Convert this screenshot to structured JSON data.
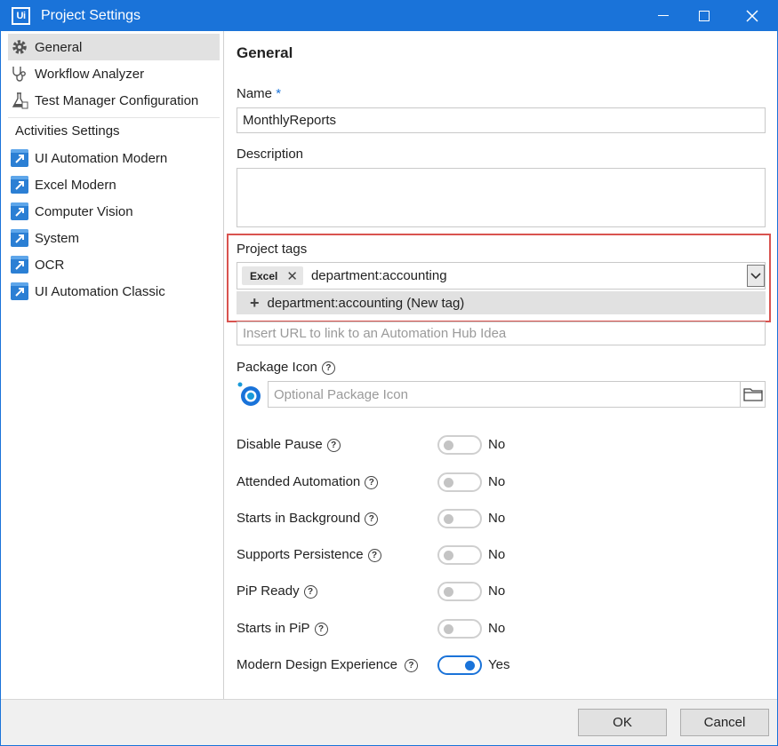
{
  "window": {
    "title": "Project Settings",
    "logo_text": "Ui"
  },
  "sidebar": {
    "items": [
      {
        "label": "General",
        "icon": "gear-icon",
        "selected": true
      },
      {
        "label": "Workflow Analyzer",
        "icon": "stethoscope-icon"
      },
      {
        "label": "Test Manager Configuration",
        "icon": "flask-icon"
      }
    ],
    "section_label": "Activities Settings",
    "activities": [
      {
        "label": "UI Automation Modern",
        "icon": "activity-package-icon"
      },
      {
        "label": "Excel Modern",
        "icon": "activity-package-icon"
      },
      {
        "label": "Computer Vision",
        "icon": "activity-package-icon"
      },
      {
        "label": "System",
        "icon": "activity-package-icon"
      },
      {
        "label": "OCR",
        "icon": "activity-package-icon"
      },
      {
        "label": "UI Automation Classic",
        "icon": "activity-package-icon"
      }
    ]
  },
  "main": {
    "title": "General",
    "name": {
      "label": "Name",
      "required_mark": "*",
      "value": "MonthlyReports"
    },
    "description": {
      "label": "Description",
      "value": ""
    },
    "project_tags": {
      "label": "Project tags",
      "chips": [
        "Excel"
      ],
      "input_value": "department:accounting",
      "suggestion": "department:accounting (New tag)"
    },
    "hub_idea": {
      "placeholder": "Insert URL to link to an Automation Hub Idea"
    },
    "package_icon": {
      "label": "Package Icon",
      "placeholder": "Optional Package Icon"
    },
    "toggles": [
      {
        "label": "Disable Pause",
        "state": "No",
        "on": false
      },
      {
        "label": "Attended Automation",
        "state": "No",
        "on": false
      },
      {
        "label": "Starts in Background",
        "state": "No",
        "on": false
      },
      {
        "label": "Supports Persistence",
        "state": "No",
        "on": false
      },
      {
        "label": "PiP Ready",
        "state": "No",
        "on": false
      },
      {
        "label": "Starts in PiP",
        "state": "No",
        "on": false
      },
      {
        "label": "Modern Design Experience",
        "state": "Yes",
        "on": true
      }
    ]
  },
  "footer": {
    "ok_label": "OK",
    "cancel_label": "Cancel"
  },
  "colors": {
    "accent": "#1a73d9",
    "highlight_border": "#d9534f"
  }
}
